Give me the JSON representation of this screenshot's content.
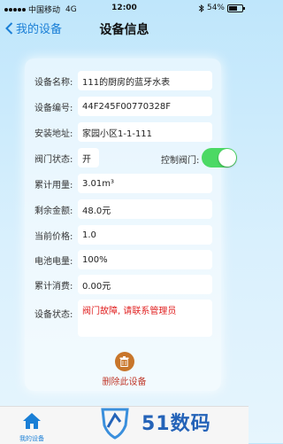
{
  "status_bar": {
    "carrier": "中国移动",
    "network": "4G",
    "time": "12:00",
    "battery": "54%",
    "battery_level": 0.54
  },
  "nav": {
    "back_label": "我的设备",
    "title": "设备信息"
  },
  "fields": {
    "device_name": {
      "label": "设备名称:",
      "value": "111的厨房的蓝牙水表"
    },
    "device_id": {
      "label": "设备编号:",
      "value": "44F245F00770328F"
    },
    "address": {
      "label": "安装地址:",
      "value": "家园小区1-1-111"
    },
    "valve_state": {
      "label": "阀门状态:",
      "value": "开"
    },
    "valve_control": {
      "label": "控制阀门:",
      "on": true
    },
    "total_usage": {
      "label": "累计用量:",
      "value": "3.01m³"
    },
    "balance": {
      "label": "剩余金额:",
      "value": "48.0元"
    },
    "price": {
      "label": "当前价格:",
      "value": "1.0"
    },
    "battery": {
      "label": "电池电量:",
      "value": "100%"
    },
    "total_spend": {
      "label": "累计消费:",
      "value": "0.00元"
    },
    "device_status": {
      "label": "设备状态:",
      "value": "阀门故障, 请联系管理员"
    }
  },
  "delete": {
    "label": "删除此设备"
  },
  "tabbar": {
    "items": [
      {
        "label": "我的设备",
        "icon": "home-icon"
      }
    ]
  },
  "watermark": {
    "text": "51数码"
  },
  "colors": {
    "accent": "#1a7fd6",
    "toggle_on": "#4cd964",
    "danger": "#e02020",
    "trash": "#c8762b"
  }
}
